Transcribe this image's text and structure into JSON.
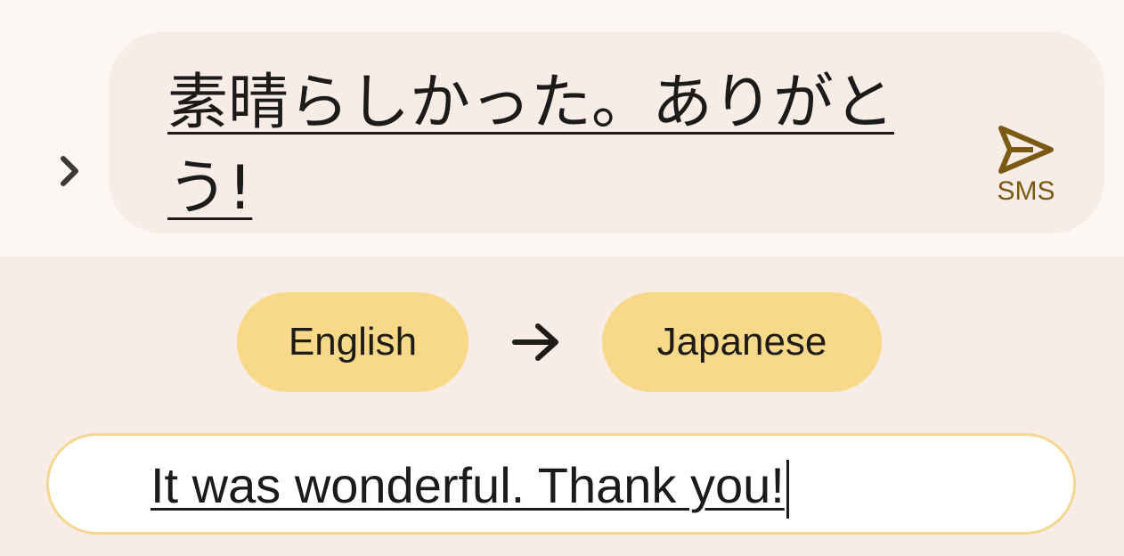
{
  "message": {
    "text": "素晴らしかった。ありがとう!",
    "send_label": "SMS"
  },
  "languages": {
    "source": "English",
    "target": "Japanese"
  },
  "input": {
    "value": "It was wonderful. Thank you!"
  },
  "icons": {
    "expand": "chevron-right-icon",
    "send": "send-icon",
    "swap": "arrow-right-icon"
  },
  "colors": {
    "accent": "#f8d98a",
    "send_icon": "#7a5a13",
    "bubble": "#f7ece6"
  }
}
